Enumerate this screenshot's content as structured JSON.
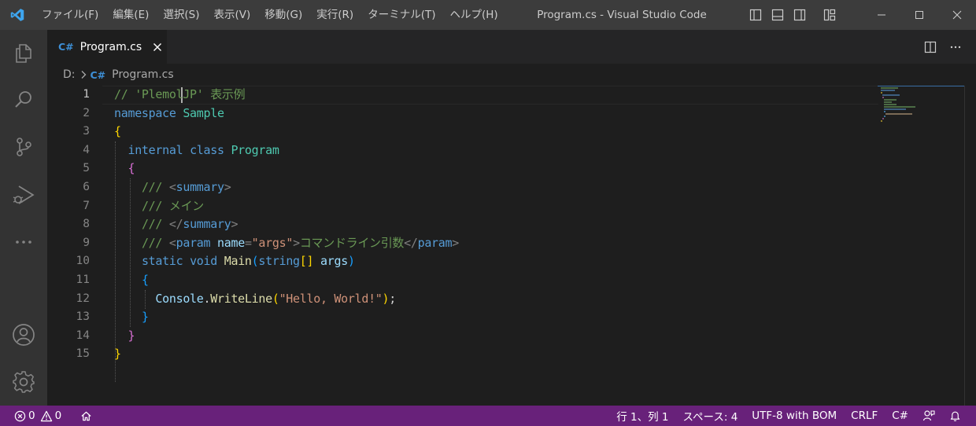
{
  "window": {
    "title": "Program.cs - Visual Studio Code",
    "menu": [
      "ファイル(F)",
      "編集(E)",
      "選択(S)",
      "表示(V)",
      "移動(G)",
      "実行(R)",
      "ターミナル(T)",
      "ヘルプ(H)"
    ]
  },
  "tabs": [
    {
      "lang": "C#",
      "label": "Program.cs",
      "active": true
    }
  ],
  "breadcrumb": {
    "drive": "D:",
    "lang": "C#",
    "file": "Program.cs"
  },
  "editor": {
    "active_line": 1,
    "line_numbers": [
      "1",
      "2",
      "3",
      "4",
      "5",
      "6",
      "7",
      "8",
      "9",
      "10",
      "11",
      "12",
      "13",
      "14",
      "15"
    ],
    "lines": {
      "l1": {
        "comment": "// 'PlemolJP' 表示例"
      },
      "l2": {
        "kw": "namespace",
        "name": "Sample"
      },
      "l3": {
        "brace": "{"
      },
      "l4": {
        "kw1": "internal",
        "kw2": "class",
        "name": "Program"
      },
      "l5": {
        "brace": "{"
      },
      "l6": {
        "slashes": "///",
        "open": "<",
        "tag": "summary",
        "close": ">"
      },
      "l7": {
        "slashes": "///",
        "text": "メイン"
      },
      "l8": {
        "slashes": "///",
        "open": "</",
        "tag": "summary",
        "close": ">"
      },
      "l9": {
        "slashes": "///",
        "open": "<",
        "tag": "param",
        "attr": "name",
        "eq": "=",
        "q1": "\"",
        "value": "args",
        "q2": "\"",
        "close": ">",
        "text": "コマンドライン引数",
        "open2": "</",
        "tag2": "param",
        "close2": ">"
      },
      "l10": {
        "kw1": "static",
        "kw2": "void",
        "fn": "Main",
        "p_open": "(",
        "type": "string",
        "arr": "[]",
        "arg": "args",
        "p_close": ")"
      },
      "l11": {
        "brace": "{"
      },
      "l12": {
        "obj": "Console",
        "dot": ".",
        "fn": "WriteLine",
        "p_open": "(",
        "str": "\"Hello, World!\"",
        "p_close": ")",
        "semi": ";"
      },
      "l13": {
        "brace": "}"
      },
      "l14": {
        "brace": "}"
      },
      "l15": {
        "brace": "}"
      }
    }
  },
  "statusbar": {
    "errors": "0",
    "warnings": "0",
    "position": "行 1、列 1",
    "indent": "スペース: 4",
    "encoding": "UTF-8 with BOM",
    "eol": "CRLF",
    "language": "C#"
  },
  "colors": {
    "statusbar": "#68217a",
    "titlebar": "#3c3c3c",
    "activitybar": "#333333",
    "editor": "#1e1e1e"
  }
}
